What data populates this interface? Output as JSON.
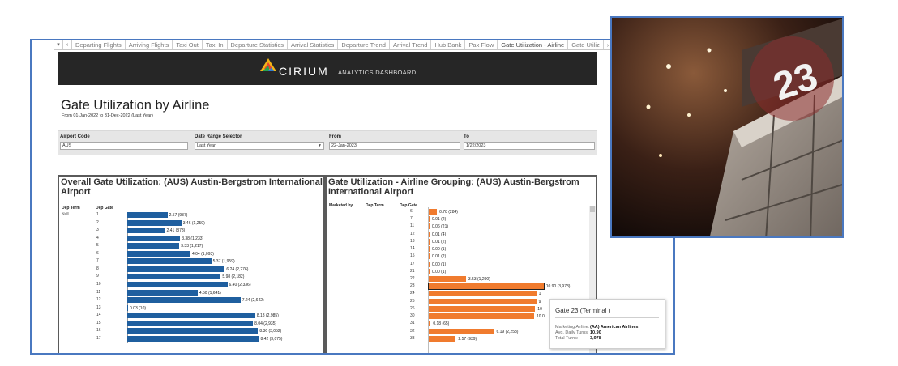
{
  "tabs": {
    "controls": [
      "▾",
      "‹"
    ],
    "items": [
      {
        "label": "Departing Flights",
        "active": false
      },
      {
        "label": "Arriving Flights",
        "active": false
      },
      {
        "label": "Taxi Out",
        "active": false
      },
      {
        "label": "Taxi In",
        "active": false
      },
      {
        "label": "Departure Statistics",
        "active": false
      },
      {
        "label": "Arrival Statistics",
        "active": false
      },
      {
        "label": "Departure Trend",
        "active": false
      },
      {
        "label": "Arrival Trend",
        "active": false
      },
      {
        "label": "Hub Bank",
        "active": false
      },
      {
        "label": "Pax Flow",
        "active": false
      },
      {
        "label": "Gate Utilization - Airline",
        "active": true
      },
      {
        "label": "Gate Utiliz",
        "active": false
      },
      {
        "label": "›",
        "active": false
      }
    ]
  },
  "header": {
    "brand": "CIRIUM",
    "subtitle": "ANALYTICS DASHBOARD"
  },
  "page": {
    "title": "Gate Utilization by Airline",
    "subtitle": "From 01-Jan-2022 to 31-Dec-2022 (Last Year)"
  },
  "filters": {
    "airport_code": {
      "label": "Airport Code",
      "value": "AUS"
    },
    "date_range": {
      "label": "Date Range Selector",
      "value": "Last Year"
    },
    "from": {
      "label": "From",
      "value": "22-Jan-2023"
    },
    "to": {
      "label": "To",
      "value": "1/22/2023"
    }
  },
  "left_panel": {
    "title": "Overall Gate Utilization: (AUS) Austin-Bergstrom International Airport",
    "col_term": "Dep Term",
    "col_gate": "Dep Gate",
    "term_label": "Null"
  },
  "right_panel": {
    "title": "Gate Utilization - Airline Grouping: (AUS) Austin-Bergstrom International Airport",
    "col_marketed": "Marketed by",
    "col_term": "Dep Term",
    "col_gate": "Dep Gate"
  },
  "tooltip": {
    "title": "Gate 23 (Terminal )",
    "rows": [
      {
        "key": "Marketing Airline:",
        "value": "(AA) American Airlines"
      },
      {
        "key": "Avg. Daily Turns:",
        "value": "10.90"
      },
      {
        "key": "Total Turns:",
        "value": "3,978"
      }
    ]
  },
  "photo": {
    "sign_text": "23"
  },
  "colors": {
    "blue": "#1f5f9f",
    "orange": "#f07b2e",
    "banner": "#262626",
    "frame": "#4a78c0"
  },
  "chart_data": [
    {
      "type": "bar",
      "orientation": "horizontal",
      "series": [
        {
          "color": "#1f5f9f"
        }
      ],
      "categories": [
        "1",
        "2",
        "3",
        "4",
        "5",
        "6",
        "7",
        "8",
        "9",
        "10",
        "11",
        "12",
        "13",
        "14",
        "15",
        "16",
        "17"
      ],
      "values": [
        2.57,
        3.46,
        2.41,
        3.38,
        3.33,
        4.04,
        5.37,
        6.24,
        5.98,
        6.4,
        4.5,
        7.24,
        0.03,
        8.18,
        8.04,
        8.36,
        8.42
      ],
      "labels": [
        "2.57 (937)",
        "3.46 (1,259)",
        "2.41 (878)",
        "3.38 (1,233)",
        "3.33 (1,217)",
        "4.04 (1,093)",
        "5.37 (1,959)",
        "6.24 (2,276)",
        "5.98 (2,182)",
        "6.40 (2,336)",
        "4.50 (1,641)",
        "7.24 (2,642)",
        "0.03 (10)",
        "8.18 (2,985)",
        "8.04 (2,935)",
        "8.36 (3,052)",
        "8.42 (3,075)"
      ]
    },
    {
      "type": "bar",
      "orientation": "horizontal",
      "series": [
        {
          "color": "#f07b2e"
        }
      ],
      "categories": [
        "6",
        "7",
        "11",
        "12",
        "13",
        "14",
        "15",
        "17",
        "21",
        "22",
        "23",
        "24",
        "25",
        "26",
        "30",
        "31",
        "32",
        "33"
      ],
      "values": [
        0.78,
        0.01,
        0.06,
        0.01,
        0.01,
        0.0,
        0.01,
        0.0,
        0.0,
        3.53,
        10.9,
        10.2,
        10.2,
        10.1,
        10.0,
        0.18,
        6.19,
        2.57
      ],
      "labels": [
        "0.78 (284)",
        "0.01 (2)",
        "0.06 (21)",
        "0.01 (4)",
        "0.01 (2)",
        "0.00 (1)",
        "0.01 (2)",
        "0.00 (1)",
        "0.00 (1)",
        "3.53 (1,290)",
        "10.90 (3,978)",
        "1",
        "9",
        "10",
        "10.0",
        "0.18 (65)",
        "6.19 (2,258)",
        "2.57 (939)"
      ],
      "selected_category": "23"
    }
  ]
}
